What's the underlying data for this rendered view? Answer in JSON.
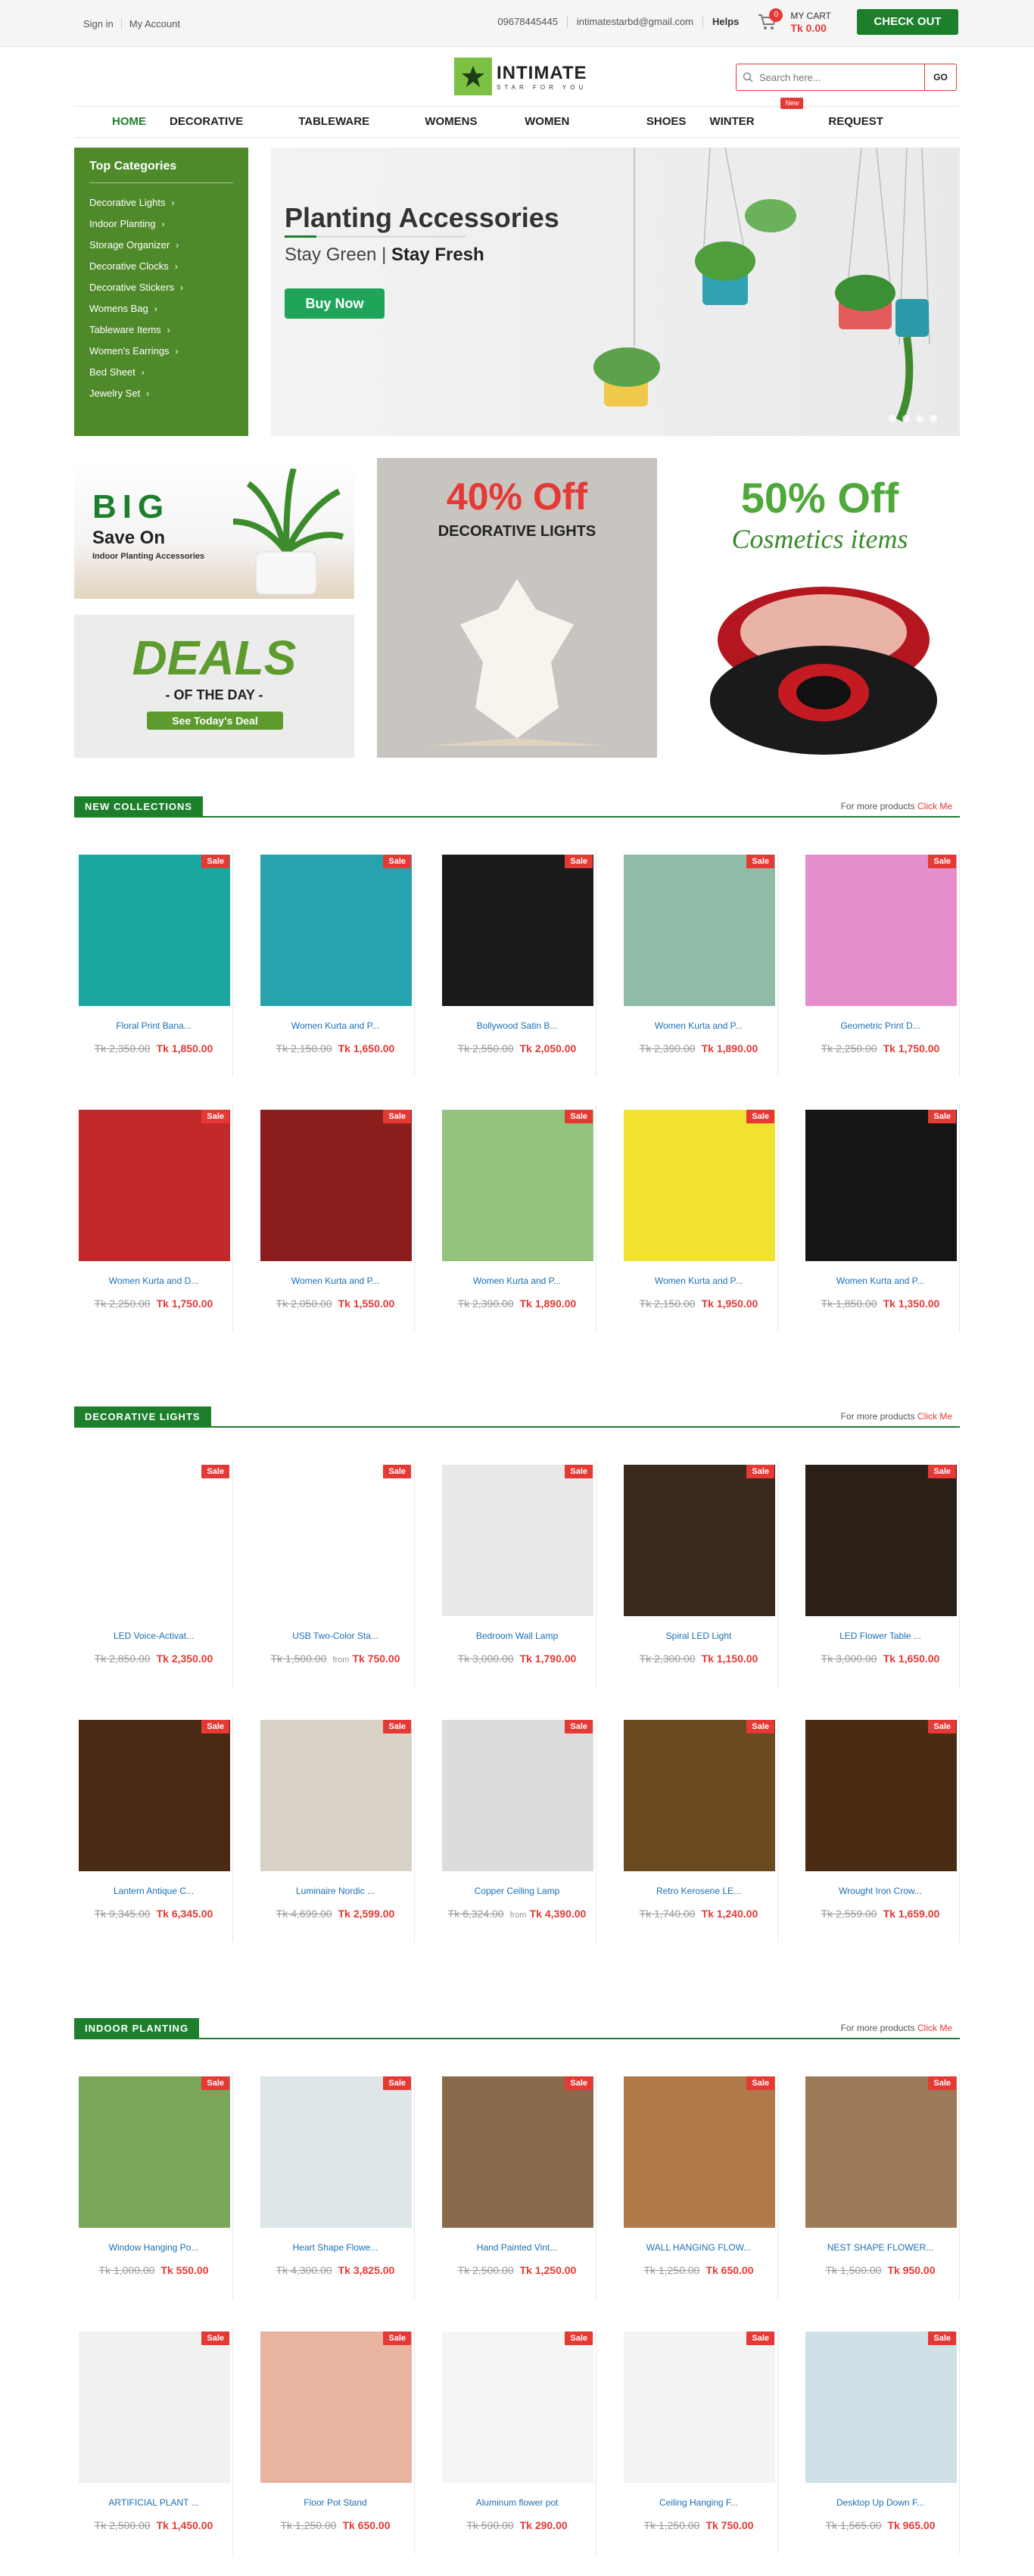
{
  "topbar": {
    "signin": "Sign in",
    "account": "My Account",
    "phone": "09678445445",
    "email": "intimatestarbd@gmail.com",
    "helps": "Helps",
    "cart_count": "0",
    "cart_label": "MY CART",
    "cart_total": "Tk 0.00",
    "checkout": "CHECK OUT"
  },
  "logo": {
    "name": "INTIMATE",
    "tagline": "STAR FOR YOU"
  },
  "search": {
    "placeholder": "Search here...",
    "go": "GO"
  },
  "nav": {
    "items": [
      "HOME",
      "DECORATIVE ITEMS",
      "TABLEWARE ITEMS",
      "WOMENS BAG",
      "WOMEN WATCHES",
      "SHOES",
      "WINTER CLOTHES",
      "REQUEST PRODUCT"
    ],
    "new_tag": "New"
  },
  "sidebar": {
    "title": "Top Categories",
    "items": [
      "Decorative Lights",
      "Indoor Planting",
      "Storage Organizer",
      "Decorative Clocks",
      "Decorative Stickers",
      "Womens Bag",
      "Tableware Items",
      "Women's Earrings",
      "Bed Sheet",
      "Jewelry Set"
    ]
  },
  "hero": {
    "title": "Planting Accessories",
    "sub_a": "Stay Green | ",
    "sub_b": "Stay Fresh",
    "button": "Buy Now"
  },
  "banners": {
    "big": "BIG",
    "save_on": "Save On",
    "planting": "Indoor Planting Accessories",
    "deals": "DEALS",
    "of_the_day": "- OF THE DAY -",
    "see_deal": "See Today's Deal",
    "off40": "40% Off",
    "dec_lights": "DECORATIVE LIGHTS",
    "off50": "50% Off",
    "cosmetics": "Cosmetics items"
  },
  "sections": [
    {
      "title": "NEW COLLECTIONS",
      "more": "For more products",
      "click": "Click Me",
      "products": [
        {
          "name": "Floral Print Bana...",
          "old": "Tk 2,350.00",
          "price": "Tk 1,850.00",
          "sale": "Sale",
          "color": "#1aa7a0"
        },
        {
          "name": "Women Kurta and P...",
          "old": "Tk 2,150.00",
          "price": "Tk 1,650.00",
          "sale": "Sale",
          "color": "#27a3ae"
        },
        {
          "name": "Bollywood Satin B...",
          "old": "Tk 2,550.00",
          "price": "Tk 2,050.00",
          "sale": "Sale",
          "color": "#1b1b1b"
        },
        {
          "name": "Women Kurta and P...",
          "old": "Tk 2,390.00",
          "price": "Tk 1,890.00",
          "sale": "Sale",
          "color": "#8fbca6"
        },
        {
          "name": "Geometric Print D...",
          "old": "Tk 2,250.00",
          "price": "Tk 1,750.00",
          "sale": "Sale",
          "color": "#e58ecb"
        },
        {
          "name": "Women Kurta and D...",
          "old": "Tk 2,250.00",
          "price": "Tk 1,750.00",
          "sale": "Sale",
          "color": "#c0282a"
        },
        {
          "name": "Women Kurta and P...",
          "old": "Tk 2,050.00",
          "price": "Tk 1,550.00",
          "sale": "Sale",
          "color": "#8c1d1d"
        },
        {
          "name": "Women Kurta and P...",
          "old": "Tk 2,390.00",
          "price": "Tk 1,890.00",
          "sale": "Sale",
          "color": "#93c47d"
        },
        {
          "name": "Women Kurta and P...",
          "old": "Tk 2,150.00",
          "price": "Tk 1,950.00",
          "sale": "Sale",
          "color": "#f2e230"
        },
        {
          "name": "Women Kurta and P...",
          "old": "Tk 1,850.00",
          "price": "Tk 1,350.00",
          "sale": "Sale",
          "color": "#151515"
        }
      ]
    },
    {
      "title": "DECORATIVE LIGHTS",
      "more": "For more products",
      "click": "Click Me",
      "products": [
        {
          "name": "LED Voice-Activat...",
          "old": "Tk 2,850.00",
          "price": "Tk 2,350.00",
          "sale": "Sale",
          "color": "#ffffff"
        },
        {
          "name": "USB Two-Color Sta...",
          "old": "Tk 1,500.00",
          "from": "from",
          "price": "Tk 750.00",
          "sale": "Sale",
          "color": "#ffffff"
        },
        {
          "name": "Bedroom Wall Lamp",
          "old": "Tk 3,000.00",
          "price": "Tk 1,790.00",
          "sale": "Sale",
          "color": "#e8e8e8"
        },
        {
          "name": "Spiral LED Light",
          "old": "Tk 2,300.00",
          "price": "Tk 1,150.00",
          "sale": "Sale",
          "color": "#3a2a1c"
        },
        {
          "name": "LED Flower Table ...",
          "old": "Tk 3,000.00",
          "price": "Tk 1,650.00",
          "sale": "Sale",
          "color": "#2b2017"
        },
        {
          "name": "Lantern Antique C...",
          "old": "Tk 9,345.00",
          "price": "Tk 6,345.00",
          "sale": "Sale",
          "color": "#4a2a14"
        },
        {
          "name": "Luminaire Nordic ...",
          "old": "Tk 4,699.00",
          "price": "Tk 2,599.00",
          "sale": "Sale",
          "color": "#d8d2c6"
        },
        {
          "name": "Copper Ceiling Lamp",
          "old": "Tk 6,324.00",
          "from": "from",
          "price": "Tk 4,390.00",
          "sale": "Sale",
          "color": "#dcdcdc"
        },
        {
          "name": "Retro Kerosene LE...",
          "old": "Tk 1,740.00",
          "price": "Tk 1,240.00",
          "sale": "Sale",
          "color": "#6b4a22"
        },
        {
          "name": "Wrought Iron Crow...",
          "old": "Tk 2,559.00",
          "price": "Tk 1,659.00",
          "sale": "Sale",
          "color": "#4a2c14"
        }
      ]
    },
    {
      "title": "INDOOR PLANTING",
      "more": "For more products",
      "click": "Click Me",
      "products": [
        {
          "name": "Window Hanging Po...",
          "old": "Tk 1,000.00",
          "price": "Tk 550.00",
          "sale": "Sale",
          "color": "#7aa65a"
        },
        {
          "name": "Heart Shape Flowe...",
          "old": "Tk 4,300.00",
          "price": "Tk 3,825.00",
          "sale": "Sale",
          "color": "#dfe6e9"
        },
        {
          "name": "Hand Painted Vint...",
          "old": "Tk 2,500.00",
          "price": "Tk 1,250.00",
          "sale": "Sale",
          "color": "#8a6a4a"
        },
        {
          "name": "WALL HANGING FLOW...",
          "old": "Tk 1,250.00",
          "price": "Tk 650.00",
          "sale": "Sale",
          "color": "#b07a4a"
        },
        {
          "name": "NEST SHAPE FLOWER...",
          "old": "Tk 1,500.00",
          "price": "Tk 950.00",
          "sale": "Sale",
          "color": "#9c7a5a"
        },
        {
          "name": "ARTIFICIAL PLANT ...",
          "old": "Tk 2,500.00",
          "price": "Tk 1,450.00",
          "sale": "Sale",
          "color": "#f1f1f1"
        },
        {
          "name": "Floor Pot Stand",
          "old": "Tk 1,250.00",
          "price": "Tk 650.00",
          "sale": "Sale",
          "color": "#e8b4a0"
        },
        {
          "name": "Aluminum flower pot",
          "old": "Tk 590.00",
          "price": "Tk 290.00",
          "sale": "Sale",
          "color": "#f5f5f5"
        },
        {
          "name": "Ceiling Hanging F...",
          "old": "Tk 1,250.00",
          "price": "Tk 750.00",
          "sale": "Sale",
          "color": "#f3f3f3"
        },
        {
          "name": "Desktop Up Down F...",
          "old": "Tk 1,565.00",
          "price": "Tk 965.00",
          "sale": "Sale",
          "color": "#cfe1e7"
        }
      ]
    }
  ]
}
